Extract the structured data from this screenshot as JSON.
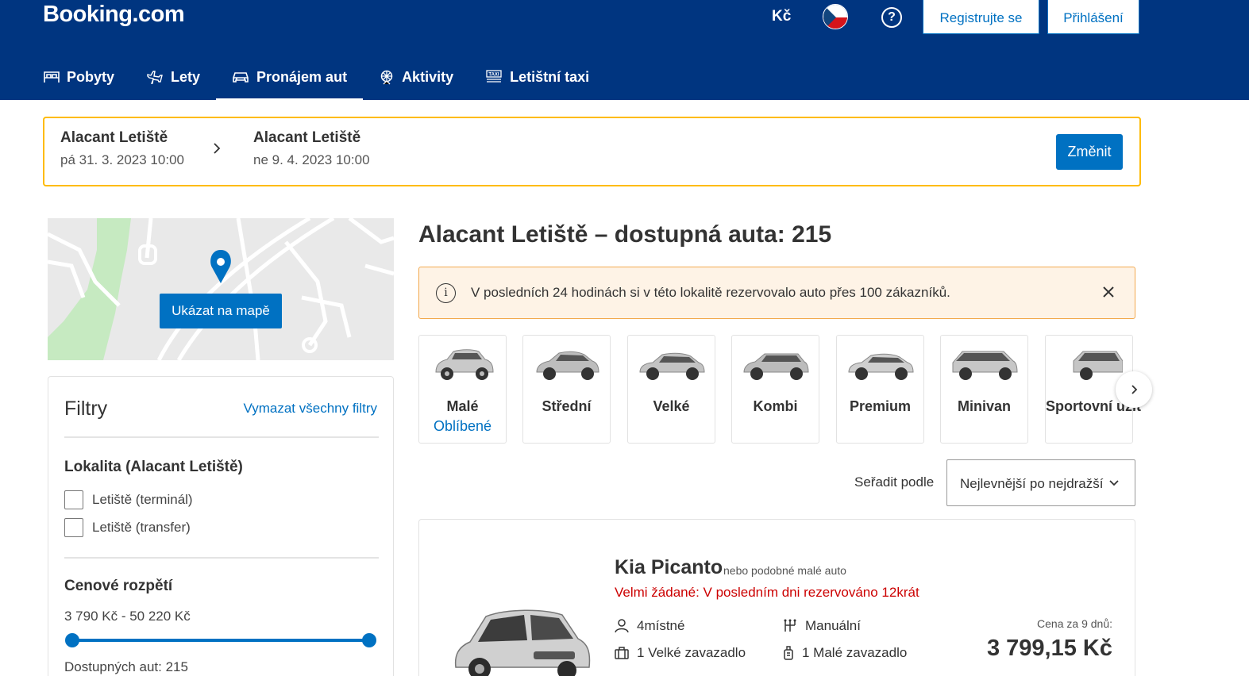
{
  "header": {
    "logo": "Booking.com",
    "currency": "Kč",
    "flag_icon": "czech-flag-icon",
    "help_icon": "help-icon",
    "register_label": "Registrujte se",
    "login_label": "Přihlášení",
    "nav": [
      {
        "label": "Pobyty",
        "icon": "bed-icon",
        "active": false
      },
      {
        "label": "Lety",
        "icon": "plane-icon",
        "active": false
      },
      {
        "label": "Pronájem aut",
        "icon": "car-icon",
        "active": true
      },
      {
        "label": "Aktivity",
        "icon": "ferris-wheel-icon",
        "active": false
      },
      {
        "label": "Letištní taxi",
        "icon": "taxi-icon",
        "active": false
      }
    ],
    "colors": {
      "brand": "#003580",
      "accent": "#0071c2",
      "highlight": "#febb02"
    }
  },
  "search": {
    "pickup_location": "Alacant Letiště",
    "pickup_date": "pá 31. 3. 2023 10:00",
    "dropoff_location": "Alacant Letiště",
    "dropoff_date": "ne 9. 4. 2023 10:00",
    "change_label": "Změnit"
  },
  "map": {
    "show_on_map_label": "Ukázat na mapě"
  },
  "filters": {
    "title": "Filtry",
    "clear_label": "Vymazat všechny filtry",
    "location_title": "Lokalita (Alacant Letiště)",
    "location_options": [
      {
        "label": "Letiště (terminál)",
        "checked": false
      },
      {
        "label": "Letiště (transfer)",
        "checked": false
      }
    ],
    "price_title": "Cenové rozpětí",
    "price_range": "3 790 Kč - 50 220 Kč",
    "price_slider": {
      "min_selected": 0,
      "max_selected": 1
    },
    "available_count": "Dostupných aut: 215"
  },
  "results": {
    "title": "Alacant Letiště – dostupná auta: 215",
    "banner_text": "V posledních 24 hodinách si v této lokalitě rezervovalo auto přes 100 zákazníků.",
    "categories": [
      {
        "label": "Malé",
        "sub": "Oblíbené"
      },
      {
        "label": "Střední",
        "sub": ""
      },
      {
        "label": "Velké",
        "sub": ""
      },
      {
        "label": "Kombi",
        "sub": ""
      },
      {
        "label": "Premium",
        "sub": ""
      },
      {
        "label": "Minivan",
        "sub": ""
      },
      {
        "label": "Sportovní užit",
        "sub": ""
      }
    ],
    "sort_label": "Seřadit podle",
    "sort_value": "Nejlevnější po nejdražší"
  },
  "car": {
    "name": "Kia Picanto",
    "similar": "nebo podobné malé auto",
    "demand": "Velmi žádané: V posledním dni rezervováno 12krát",
    "seats": "4místné",
    "transmission": "Manuální",
    "large_bags": "1 Velké zavazadlo",
    "small_bags": "1 Malé zavazadlo",
    "price_label": "Cena za 9 dnů:",
    "price": "3 799,15 Kč"
  }
}
